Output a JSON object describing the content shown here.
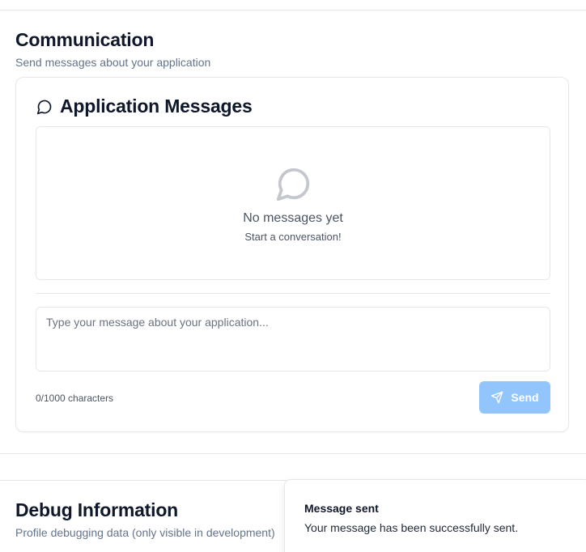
{
  "communication": {
    "title": "Communication",
    "subtitle": "Send messages about your application"
  },
  "messages_card": {
    "title": "Application Messages",
    "empty_title": "No messages yet",
    "empty_subtitle": "Start a conversation!",
    "input_placeholder": "Type your message about your application...",
    "input_value": "",
    "char_count": "0/1000 characters",
    "send_label": "Send",
    "header_icon": "message-circle-icon",
    "empty_icon": "message-circle-icon",
    "send_icon": "send-icon",
    "send_button_color": "#93c5fd"
  },
  "debug": {
    "title": "Debug Information",
    "subtitle": "Profile debugging data (only visible in development)"
  },
  "toast": {
    "title": "Message sent",
    "body": "Your message has been successfully sent."
  }
}
